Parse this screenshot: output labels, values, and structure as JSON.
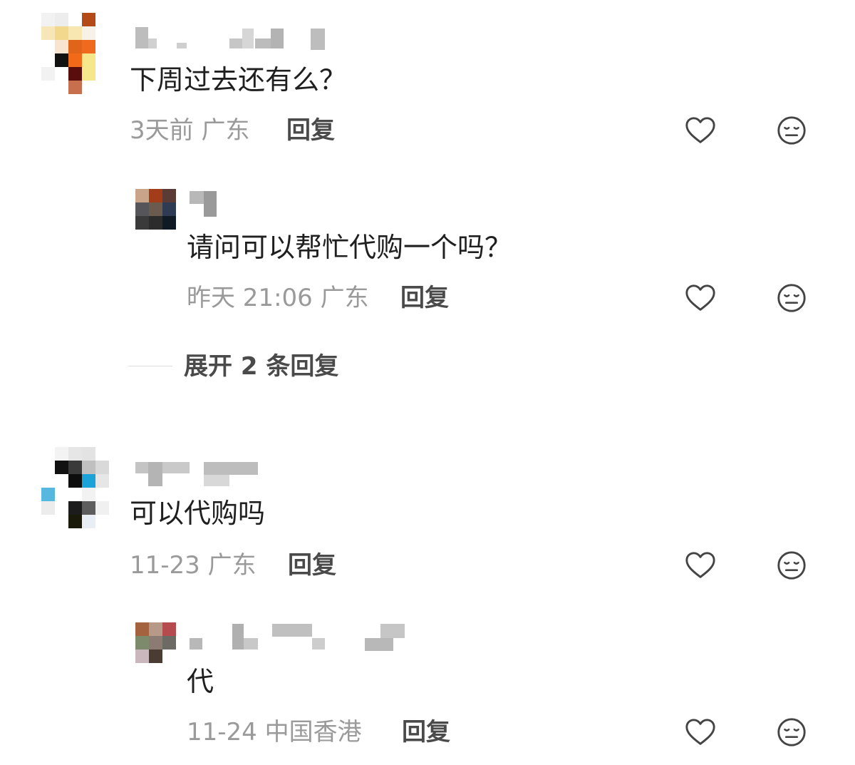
{
  "comments": [
    {
      "text": "下周过去还有么？",
      "time": "3天前",
      "location": "广东",
      "reply_label": "回复",
      "like_icon": "heart-icon",
      "dislike_icon": "neutral-face-icon",
      "replies": [
        {
          "text": "请问可以帮忙代购一个吗？",
          "time": "昨天 21:06",
          "location": "广东",
          "reply_label": "回复"
        }
      ],
      "expand_label": "展开 2 条回复"
    },
    {
      "text": "可以代购吗",
      "time": "11-23",
      "location": "广东",
      "reply_label": "回复",
      "replies": [
        {
          "text": "代",
          "time": "11-24",
          "location": "中国香港",
          "reply_label": "回复"
        }
      ]
    }
  ],
  "colors": {
    "text": "#1f1f1f",
    "meta": "#9a9a9a",
    "reply": "#4a4a4a",
    "icon": "#444444"
  }
}
